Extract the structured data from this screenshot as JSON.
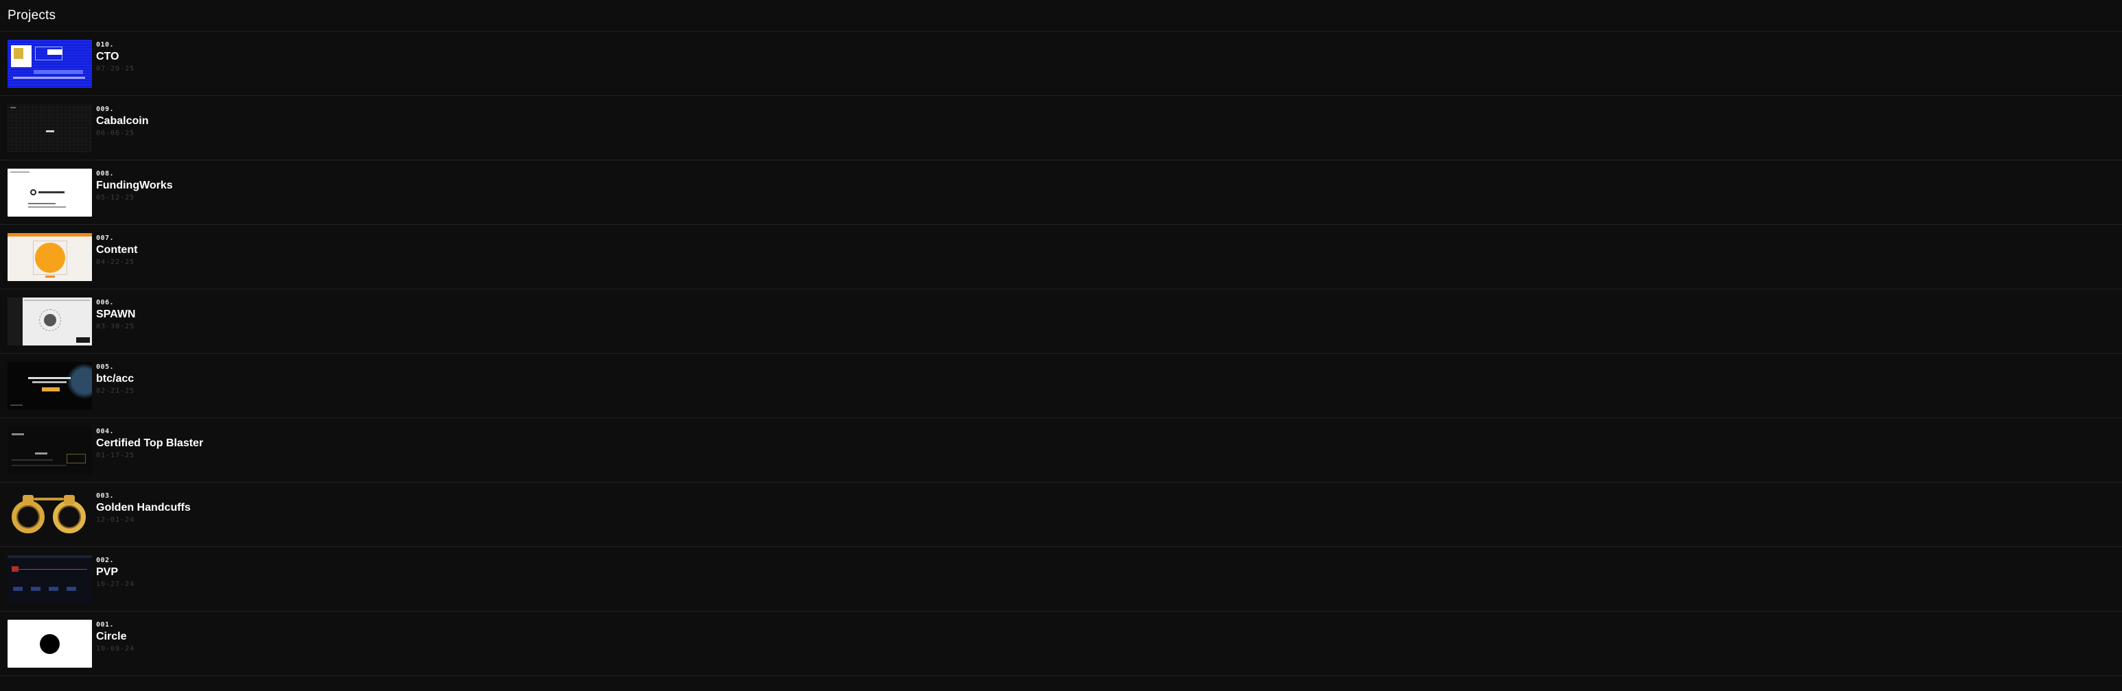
{
  "page": {
    "title": "Projects"
  },
  "projects": [
    {
      "number": "010.",
      "name": "CTO",
      "date": "07-29-25",
      "thumbnail": "cto-thumbnail"
    },
    {
      "number": "009.",
      "name": "Cabalcoin",
      "date": "06-06-25",
      "thumbnail": "cabalcoin-thumbnail"
    },
    {
      "number": "008.",
      "name": "FundingWorks",
      "date": "05-12-25",
      "thumbnail": "fundingworks-thumbnail"
    },
    {
      "number": "007.",
      "name": "Content",
      "date": "04-22-25",
      "thumbnail": "content-thumbnail"
    },
    {
      "number": "006.",
      "name": "SPAWN",
      "date": "03-30-25",
      "thumbnail": "spawn-thumbnail"
    },
    {
      "number": "005.",
      "name": "btc/acc",
      "date": "02-21-25",
      "thumbnail": "btc-acc-thumbnail"
    },
    {
      "number": "004.",
      "name": "Certified Top Blaster",
      "date": "01-17-25",
      "thumbnail": "certified-top-blaster-thumbnail"
    },
    {
      "number": "003.",
      "name": "Golden Handcuffs",
      "date": "12-01-24",
      "thumbnail": "golden-handcuffs-thumbnail"
    },
    {
      "number": "002.",
      "name": "PVP",
      "date": "10-27-24",
      "thumbnail": "pvp-thumbnail"
    },
    {
      "number": "001.",
      "name": "Circle",
      "date": "10-09-24",
      "thumbnail": "circle-thumbnail"
    }
  ],
  "colors": {
    "background": "#0e0e0e",
    "divider": "#222222",
    "text": "#ffffff",
    "date_text": "#3e3e3e"
  }
}
